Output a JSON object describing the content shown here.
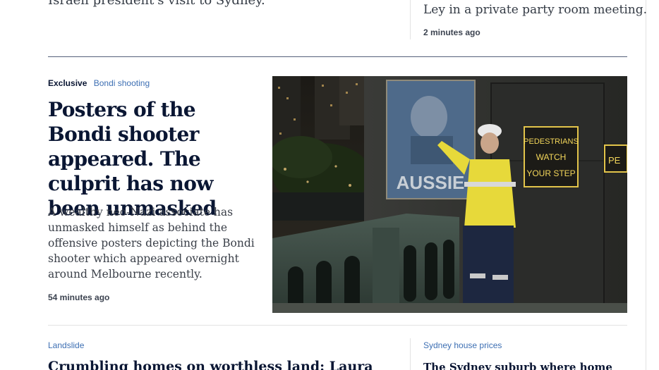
{
  "top_row": {
    "left_text": "Israeli president's visit to Sydney.",
    "right_text": "Ley in a private party room meeting.",
    "right_time": "2 minutes ago"
  },
  "main_story": {
    "kicker_exclusive": "Exclusive",
    "kicker_topic": "Bondi shooting",
    "headline": "Posters of the Bondi shooter appeared. The culprit has now been unmasked",
    "standfirst": "A wealthy neo-Nazi associate has unmasked himself as behind the offensive posters depicting the Bondi shooter which appeared overnight around Melbourne recently.",
    "time": "54 minutes ago",
    "image": {
      "poster_text": "AUSSIE",
      "sign_lines": [
        "PEDESTRIANS",
        "WATCH",
        "YOUR STEP"
      ],
      "sign_partial": "PE"
    }
  },
  "bottom_row": {
    "left_kicker": "Landslide",
    "left_headline": "Crumbling homes on worthless land: Laura",
    "right_kicker": "Sydney house prices",
    "right_headline": "The Sydney suburb where home"
  }
}
